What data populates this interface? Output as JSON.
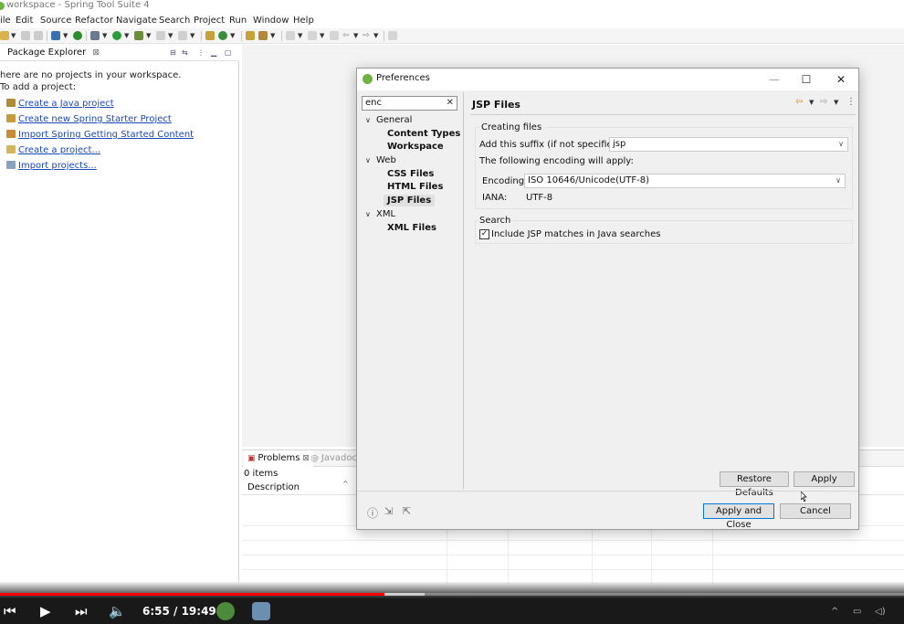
{
  "window": {
    "title": "workspace - Spring Tool Suite 4"
  },
  "menu": [
    "ile",
    "Edit",
    "Source",
    "Refactor",
    "Navigate",
    "Search",
    "Project",
    "Run",
    "Window",
    "Help"
  ],
  "package_explorer": {
    "tab": "Package Explorer",
    "message_line1": "here are no projects in your workspace.",
    "message_line2": "To add a project:",
    "links": [
      "Create a Java project",
      "Create new Spring Starter Project",
      "Import Spring Getting Started Content",
      "Create a project...",
      "Import projects..."
    ]
  },
  "bottom_panel": {
    "tabs": [
      "Problems",
      "Javadoc"
    ],
    "count": "0 items",
    "column": "Description"
  },
  "preferences": {
    "title": "Preferences",
    "filter": "enc",
    "tree": {
      "general": "General",
      "content_types": "Content Types",
      "workspace": "Workspace",
      "web": "Web",
      "css_files": "CSS Files",
      "html_files": "HTML Files",
      "jsp_files": "JSP Files",
      "xml": "XML",
      "xml_files": "XML Files"
    },
    "page_title": "JSP Files",
    "creating_files": {
      "label": "Creating files",
      "suffix_label": "Add this suffix (if not specified):",
      "suffix_value": "jsp",
      "encoding_note": "The following encoding will apply:",
      "encoding_label": "Encoding:",
      "encoding_value": "ISO 10646/Unicode(UTF-8)",
      "iana_label": "IANA:",
      "iana_value": "UTF-8"
    },
    "search": {
      "label": "Search",
      "include_label": "Include JSP matches in Java searches",
      "include_checked": true
    },
    "buttons": {
      "restore": "Restore Defaults",
      "apply": "Apply",
      "apply_close": "Apply and Close",
      "cancel": "Cancel"
    }
  },
  "video": {
    "time": "6:55 / 19:49",
    "progress_played": 0.425,
    "progress_buffered": 0.47
  }
}
